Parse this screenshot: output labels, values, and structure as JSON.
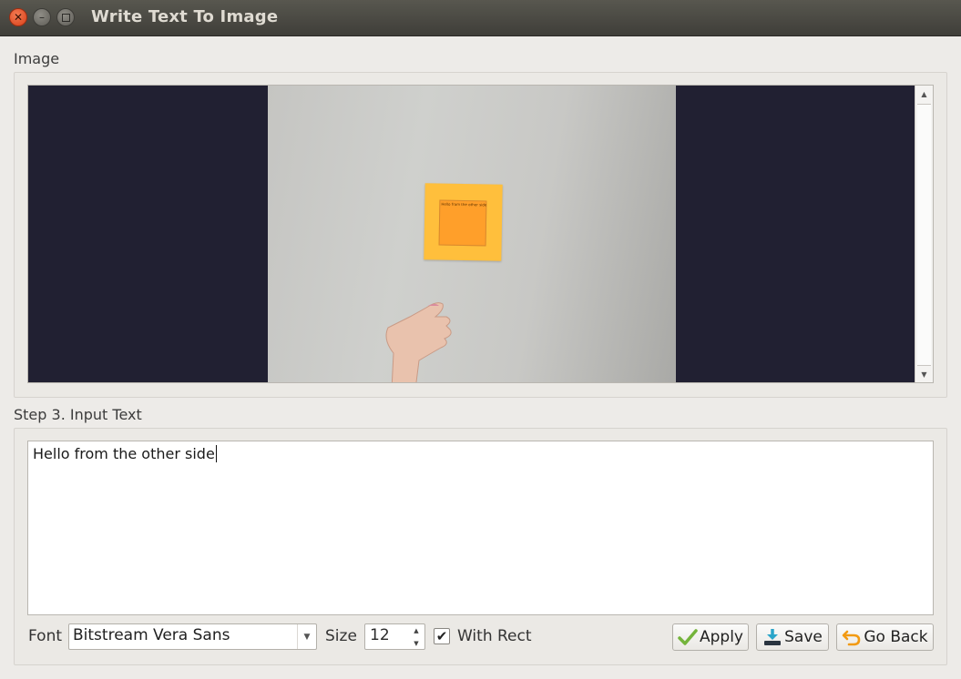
{
  "window": {
    "title": "Write Text To Image"
  },
  "image_section": {
    "label": "Image",
    "sticky_note_text": "Hello from the other side"
  },
  "text_section": {
    "label": "Step 3. Input Text",
    "input_value": "Hello from the other side"
  },
  "controls": {
    "font_label": "Font",
    "font_value": "Bitstream Vera Sans",
    "size_label": "Size",
    "size_value": "12",
    "with_rect_label": "With Rect",
    "with_rect_checked": true,
    "apply_label": "Apply",
    "save_label": "Save",
    "go_back_label": "Go Back"
  },
  "icons": {
    "apply": "checkmark-icon",
    "save": "download-icon",
    "go_back": "undo-arrow-icon"
  },
  "colors": {
    "image_background": "#212032",
    "sticky_note": "#ffbf3c",
    "text_rect": "#ff9f2a",
    "apply_icon": "#74b43b",
    "save_icon": "#2aa5c9",
    "go_back_icon": "#f29a12"
  }
}
